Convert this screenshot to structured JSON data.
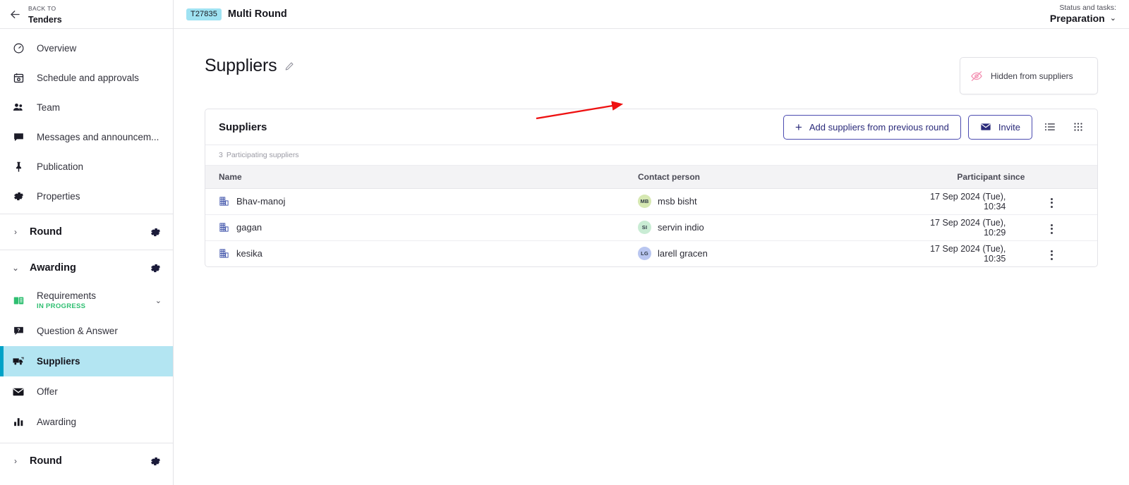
{
  "sidebar": {
    "back": {
      "label": "BACK TO",
      "title": "Tenders",
      "icon": "arrow-left-icon"
    },
    "items": [
      {
        "label": "Overview",
        "icon": "gauge-icon"
      },
      {
        "label": "Schedule and approvals",
        "icon": "calendar-icon"
      },
      {
        "label": "Team",
        "icon": "people-icon"
      },
      {
        "label": "Messages and announcem...",
        "icon": "chat-icon"
      },
      {
        "label": "Publication",
        "icon": "pin-icon"
      },
      {
        "label": "Properties",
        "icon": "gear-icon"
      }
    ],
    "groups": [
      {
        "name": "Round",
        "expanded": false,
        "chevron": "›",
        "gear": "gear-icon"
      },
      {
        "name": "Awarding",
        "expanded": true,
        "chevron": "⌄",
        "gear": "gear-icon"
      },
      {
        "name": "Round",
        "expanded": false,
        "chevron": "›",
        "gear": "gear-icon"
      }
    ],
    "awarding_items": [
      {
        "label": "Requirements",
        "status": "IN PROGRESS",
        "icon": "book-icon",
        "active": false,
        "chevron": "⌄"
      },
      {
        "label": "Question & Answer",
        "status": "",
        "icon": "question-chat-icon",
        "active": false
      },
      {
        "label": "Suppliers",
        "status": "",
        "icon": "truck-icon",
        "active": true
      },
      {
        "label": "Offer",
        "status": "",
        "icon": "envelope-icon",
        "active": false
      },
      {
        "label": "Awarding",
        "status": "",
        "icon": "bar-chart-icon",
        "active": false
      }
    ]
  },
  "topbar": {
    "tender_id": "T27835",
    "tender_name": "Multi Round",
    "status_label": "Status and tasks:",
    "status_value": "Preparation",
    "status_chevron": "⌄"
  },
  "page": {
    "title": "Suppliers",
    "edit_icon": "pencil-icon",
    "hidden_card": {
      "text": "Hidden from suppliers",
      "icon": "eye-off-icon"
    }
  },
  "card": {
    "title": "Suppliers",
    "add_button": {
      "label": "Add suppliers from previous round",
      "icon": "plus-icon"
    },
    "invite_button": {
      "label": "Invite",
      "icon": "envelope-icon"
    },
    "list_view_icon": "list-view-icon",
    "grid_view_icon": "grid-view-icon",
    "count_number": "3",
    "count_label": "Participating suppliers",
    "columns": [
      "Name",
      "Contact person",
      "Participant since"
    ],
    "rows": [
      {
        "name": "Bhav-manoj",
        "name_icon": "company-building-icon",
        "contact": "msb bisht",
        "initials": "MB",
        "avatar_color": "#d6e8b2",
        "since": "17 Sep 2024 (Tue), 10:34",
        "menu_icon": "kebab-menu-icon"
      },
      {
        "name": "gagan",
        "name_icon": "company-building-icon",
        "contact": "servin indio",
        "initials": "SI",
        "avatar_color": "#c9ecd4",
        "since": "17 Sep 2024 (Tue), 10:29",
        "menu_icon": "kebab-menu-icon"
      },
      {
        "name": "kesika",
        "name_icon": "company-building-icon",
        "contact": "larell gracen",
        "initials": "LG",
        "avatar_color": "#b9c6f0",
        "since": "17 Sep 2024 (Tue), 10:35",
        "menu_icon": "kebab-menu-icon"
      }
    ]
  },
  "annotation": {
    "type": "red-arrow",
    "color": "#ee1111"
  },
  "colors": {
    "accent_cyan": "#00a2c7",
    "selected_bg": "#b3e5f2",
    "badge_bg": "#9fe2f2",
    "button_border": "#4b4bb0",
    "in_progress": "#2fbf71",
    "hidden_icon": "#f48fb1"
  }
}
